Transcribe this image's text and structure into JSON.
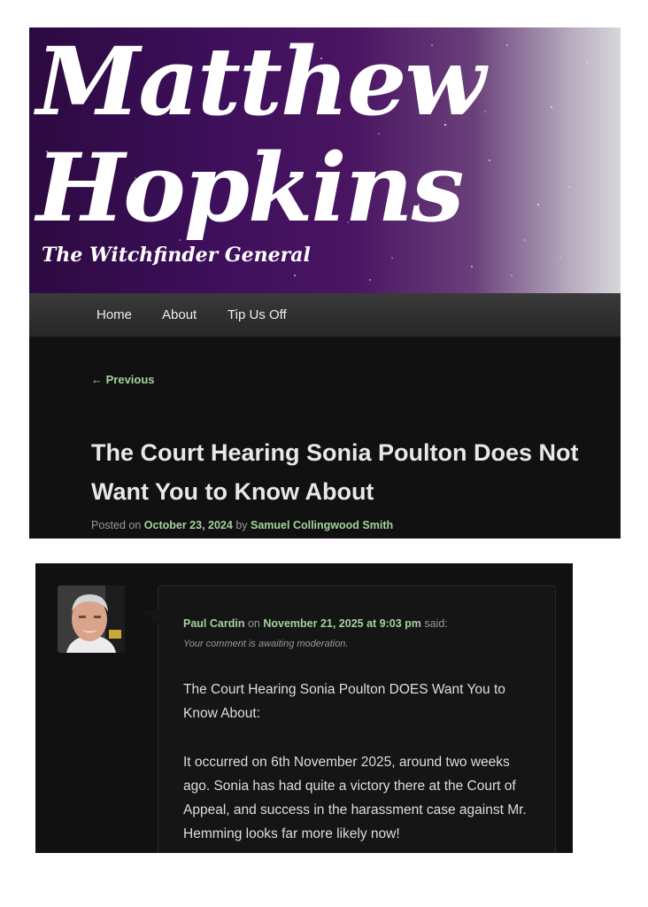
{
  "header": {
    "title_line_1": "Matthew",
    "title_line_2": "Hopkins",
    "tagline": "The Witchfinder General"
  },
  "nav": {
    "items": [
      "Home",
      "About",
      "Tip Us Off"
    ]
  },
  "post": {
    "previous_link": "← Previous",
    "title": "The Court Hearing Sonia Poulton Does Not Want You to Know About",
    "meta_posted_on": "Posted on",
    "date": "October 23, 2024",
    "meta_by": "by",
    "author": "Samuel Collingwood Smith"
  },
  "comment": {
    "author": "Paul Cardin",
    "on": "on",
    "date": "November 21, 2025 at 9:03 pm",
    "said": "said:",
    "moderation": "Your comment is awaiting moderation.",
    "paragraphs": [
      "The Court Hearing Sonia Poulton DOES Want You to Know About:",
      "It occurred on 6th November 2025, around two weeks ago. Sonia has had quite a victory there at the Court of Appeal, and success in the harassment case against Mr. Hemming looks far more likely now!"
    ]
  },
  "colors": {
    "link_green": "#a3d39c",
    "panel_bg": "#111111",
    "banner_purple": "#3d0f5a"
  }
}
